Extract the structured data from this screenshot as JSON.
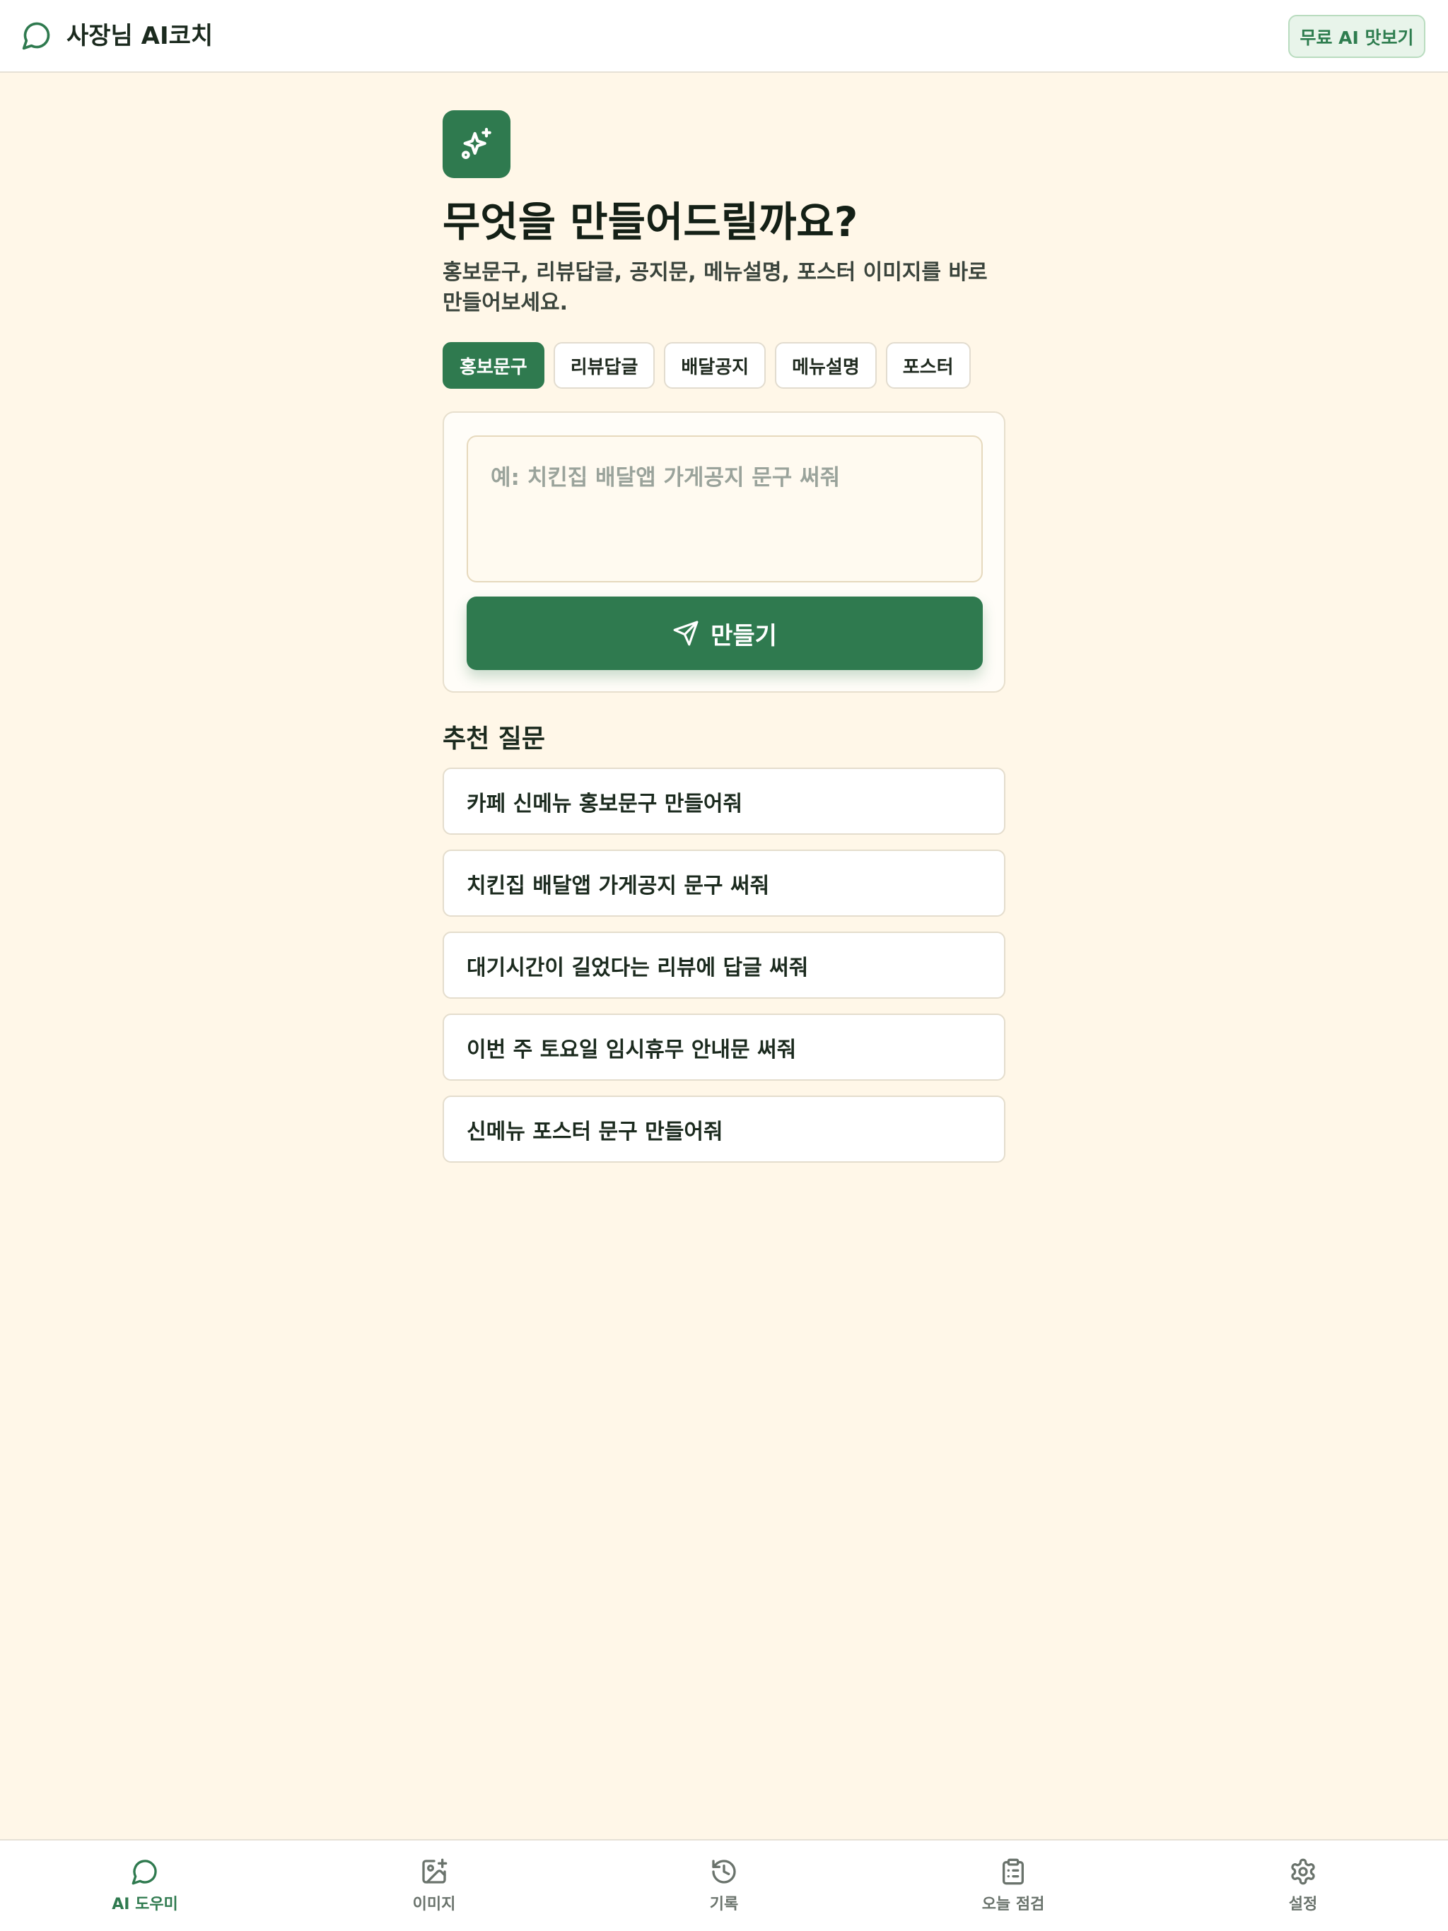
{
  "header": {
    "title": "사장님 AI코치",
    "trial_button": "무료 AI 맛보기",
    "brand_icon": "chat-bubble-icon"
  },
  "hero": {
    "icon": "sparkles-icon",
    "title": "무엇을 만들어드릴까요?",
    "subtitle": "홍보문구, 리뷰답글, 공지문, 메뉴설명, 포스터 이미지를 바로 만들어보세요."
  },
  "chips": [
    {
      "label": "홍보문구",
      "active": true
    },
    {
      "label": "리뷰답글",
      "active": false
    },
    {
      "label": "배달공지",
      "active": false
    },
    {
      "label": "메뉴설명",
      "active": false
    },
    {
      "label": "포스터",
      "active": false
    }
  ],
  "composer": {
    "placeholder": "예: 치킨집 배달앱 가게공지 문구 써줘",
    "value": "",
    "button_label": "만들기",
    "button_icon": "send-icon"
  },
  "recommendations": {
    "title": "추천 질문",
    "items": [
      "카페 신메뉴 홍보문구 만들어줘",
      "치킨집 배달앱 가게공지 문구 써줘",
      "대기시간이 길었다는 리뷰에 답글 써줘",
      "이번 주 토요일 임시휴무 안내문 써줘",
      "신메뉴 포스터 문구 만들어줘"
    ]
  },
  "bottom_nav": [
    {
      "label": "AI 도우미",
      "icon": "chat-bubble-icon",
      "active": true
    },
    {
      "label": "이미지",
      "icon": "image-plus-icon",
      "active": false
    },
    {
      "label": "기록",
      "icon": "history-icon",
      "active": false
    },
    {
      "label": "오늘 점검",
      "icon": "clipboard-icon",
      "active": false
    },
    {
      "label": "설정",
      "icon": "gear-icon",
      "active": false
    }
  ],
  "colors": {
    "accent": "#2f7a4f",
    "background": "#fff7e8"
  }
}
